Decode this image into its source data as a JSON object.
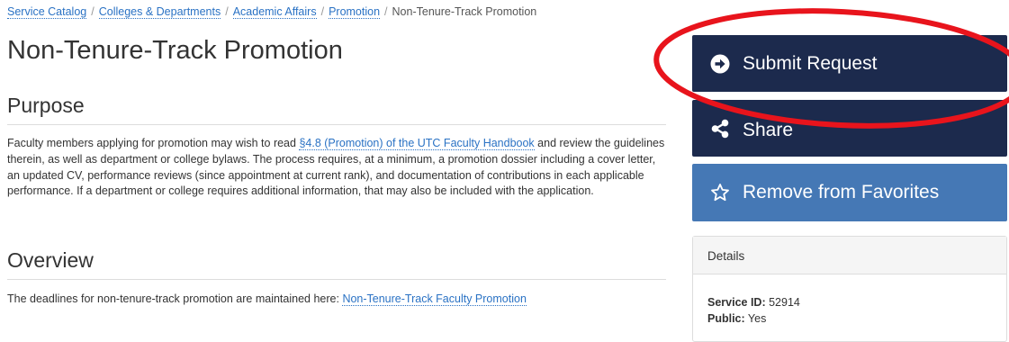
{
  "breadcrumb": {
    "items": [
      "Service Catalog",
      "Colleges & Departments",
      "Academic Affairs",
      "Promotion"
    ],
    "separator": "/",
    "current": "Non-Tenure-Track Promotion"
  },
  "page": {
    "title": "Non-Tenure-Track Promotion"
  },
  "purpose": {
    "heading": "Purpose",
    "text_before_link": "Faculty members applying for promotion may wish to read ",
    "link": "§4.8 (Promotion) of the UTC Faculty Handbook",
    "text_after_link": " and review the guidelines therein, as well as department or college bylaws. The process requires, at a minimum, a promotion dossier including a cover letter, an updated CV, performance reviews (since appointment at current rank), and documentation of contributions in each applicable performance. If a department or college requires additional information, that may also be included with the application."
  },
  "overview": {
    "heading": "Overview",
    "text_before_link": "The deadlines for non-tenure-track promotion are maintained here: ",
    "link": "Non-Tenure-Track Faculty Promotion"
  },
  "actions": {
    "submit_label": "Submit Request",
    "share_label": "Share",
    "favorite_label": "Remove from Favorites"
  },
  "details": {
    "heading": "Details",
    "service_id_label": "Service ID:",
    "service_id_value": "52914",
    "public_label": "Public:",
    "public_value": "Yes"
  },
  "icons": {
    "submit": "circle-arrow-right-icon",
    "share": "share-icon",
    "favorite": "star-outline-icon"
  },
  "colors": {
    "link": "#2a72c4",
    "dark_button": "#1c2a4d",
    "favorite_button": "#4578b5",
    "annotation": "#e8141c"
  }
}
